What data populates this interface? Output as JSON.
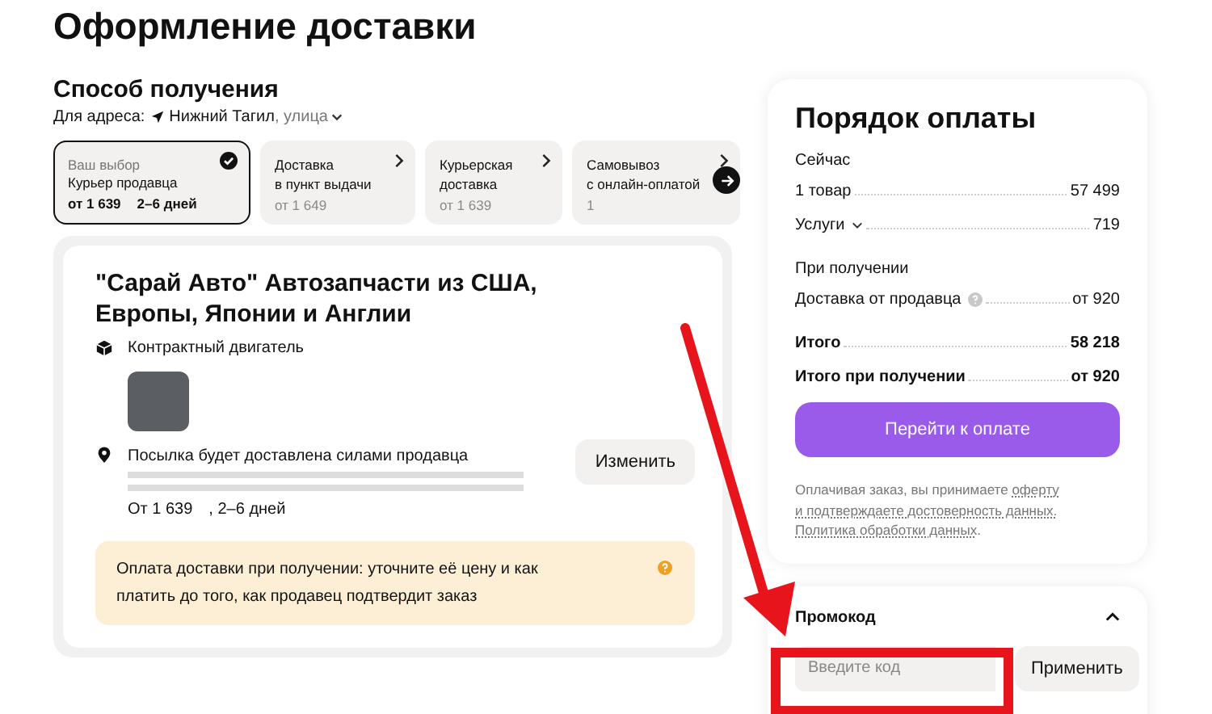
{
  "page_title": "Оформление доставки",
  "delivery": {
    "heading": "Способ получения",
    "address_label": "Для адреса:",
    "city": "Нижний Тагил",
    "street": ", улица",
    "options": [
      {
        "selected": true,
        "caption": "Ваш выбор",
        "title": [
          "Курьер продавца"
        ],
        "price": "от 1 639",
        "days": "2–6 дней"
      },
      {
        "selected": false,
        "title": [
          "Доставка",
          "в пункт выдачи"
        ],
        "price": "от 1 649"
      },
      {
        "selected": false,
        "title": [
          "Курьерская",
          "доставка"
        ],
        "price": "от 1 639"
      },
      {
        "selected": false,
        "title": [
          "Самовывоз",
          "с онлайн-оплатой"
        ],
        "price": "1"
      }
    ]
  },
  "seller": {
    "name": "\"Сарай Авто\" Автозапчасти из США, Европы, Японии и Англии",
    "item": "Контрактный двигатель",
    "shipping": "Посылка будет доставлена силами продавца",
    "price": "От 1 639",
    "days": ", 2–6 дней",
    "change_button": "Изменить",
    "notice": "Оплата доставки при получении: уточните её цену и как платить до того, как продавец подтвердит заказ"
  },
  "summary": {
    "title": "Порядок оплаты",
    "sections": [
      {
        "heading": "Сейчас",
        "rows": [
          {
            "label": "1 товар",
            "value": "57 499",
            "kind": "plain"
          },
          {
            "label": "Услуги",
            "value": "719",
            "kind": "expand"
          }
        ]
      },
      {
        "heading": "При получении",
        "rows": [
          {
            "label": "Доставка от продавца",
            "value": "от 920",
            "kind": "info"
          }
        ]
      }
    ],
    "totals": [
      {
        "label": "Итого",
        "value": "58 218"
      },
      {
        "label": "Итого при получении",
        "value": "от 920"
      }
    ],
    "pay_button": "Перейти к оплате",
    "legal": [
      "Оплачивая заказ, вы принимаете ",
      "оферту",
      "и подтверждаете достоверность данных.",
      "Политика обработки данных",
      "."
    ]
  },
  "promo": {
    "heading": "Промокод",
    "expanded": true,
    "placeholder": "Введите код",
    "apply_button": "Применить"
  }
}
